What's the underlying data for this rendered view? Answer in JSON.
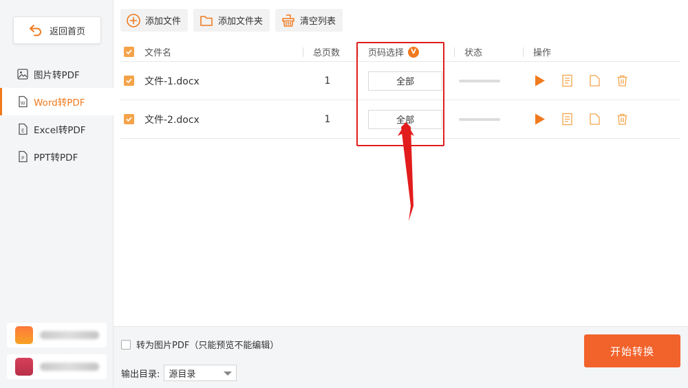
{
  "sidebar": {
    "back_label": "返回首页",
    "items": [
      {
        "label": "图片转PDF",
        "icon": "image-file-icon",
        "active": false
      },
      {
        "label": "Word转PDF",
        "icon": "word-file-icon",
        "active": true
      },
      {
        "label": "Excel转PDF",
        "icon": "excel-file-icon",
        "active": false
      },
      {
        "label": "PPT转PDF",
        "icon": "ppt-file-icon",
        "active": false
      }
    ]
  },
  "toolbar": {
    "add_file_label": "添加文件",
    "add_folder_label": "添加文件夹",
    "clear_list_label": "清空列表"
  },
  "table": {
    "headers": {
      "name": "文件名",
      "pages": "总页数",
      "range": "页码选择",
      "range_badge": "V",
      "status": "状态",
      "ops": "操作"
    },
    "rows": [
      {
        "name": "文件-1.docx",
        "pages": "1",
        "range": "全部",
        "checked": true
      },
      {
        "name": "文件-2.docx",
        "pages": "1",
        "range": "全部",
        "checked": true
      }
    ]
  },
  "bottom": {
    "convert_image_label": "转为图片PDF（只能预览不能编辑）",
    "output_dir_label": "输出目录:",
    "output_dir_value": "源目录",
    "start_label": "开始转换"
  },
  "colors": {
    "accent": "#f07a1f",
    "start_button": "#f2622b",
    "checkbox": "#f5a34a",
    "annotation": "#e21c1c"
  }
}
